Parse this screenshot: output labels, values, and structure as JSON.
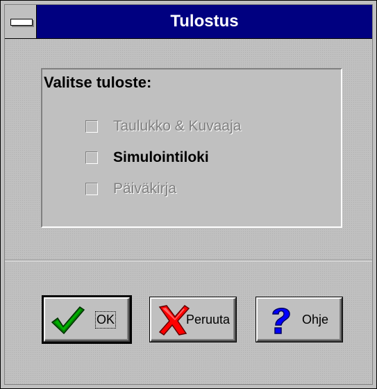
{
  "dialog": {
    "title": "Tulostus"
  },
  "group": {
    "label": "Valitse tuloste:",
    "options": [
      {
        "label": "Taulukko & Kuvaaja",
        "enabled": false,
        "checked": false
      },
      {
        "label": "Simulointiloki",
        "enabled": true,
        "checked": false
      },
      {
        "label": "Päiväkirja",
        "enabled": false,
        "checked": false
      }
    ]
  },
  "buttons": {
    "ok_label": "OK",
    "cancel_label": "Peruuta",
    "help_label": "Ohje"
  },
  "icons": {
    "system_menu": "system-menu-icon",
    "ok": "green-checkmark-icon",
    "cancel": "red-x-icon",
    "help": "question-mark-icon"
  },
  "colors": {
    "title_bar": "#000080",
    "face": "#c0c0c0",
    "disabled_text": "#808080",
    "check_green": "#008000",
    "cancel_red": "#ff0000",
    "help_blue": "#0000ff"
  }
}
